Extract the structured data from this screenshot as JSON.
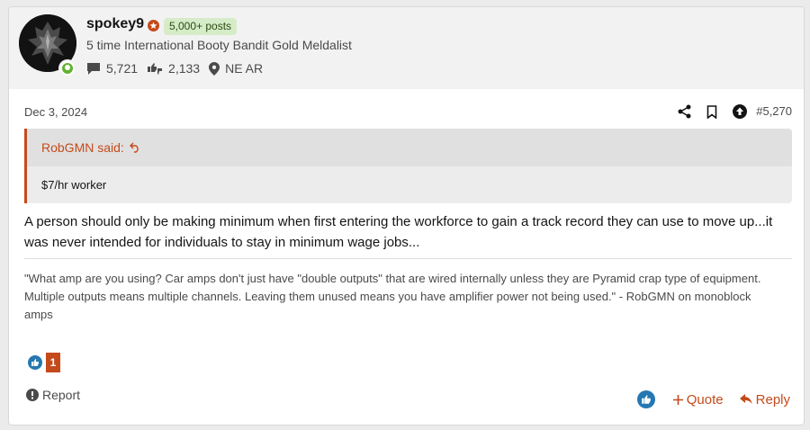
{
  "user": {
    "name": "spokey9",
    "post_badge": "5,000+ posts",
    "title": "5 time International Booty Bandit Gold Meldalist",
    "messages": "5,721",
    "reaction_score": "2,133",
    "location": "NE AR",
    "online_status_color": "#63b132"
  },
  "post": {
    "date": "Dec 3, 2024",
    "number": "#5,270",
    "quote": {
      "author_label": "RobGMN said:",
      "text": "$7/hr worker"
    },
    "body": "A person should only be making minimum when first entering the workforce to gain a track record they can use to move up...it was never intended for individuals to stay in minimum wage jobs...",
    "signature_line1": "\"What amp are you using? Car amps don't just have \"double outputs\" that are wired internally unless they are Pyramid crap type of equipment.",
    "signature_line2": "Multiple outputs means multiple channels. Leaving them unused means you have amplifier power not being used.\" - RobGMN on monoblock amps",
    "reaction_count": "1"
  },
  "actions": {
    "report": "Report",
    "quote": "Quote",
    "reply": "Reply"
  },
  "colors": {
    "accent": "#c44a1b",
    "like_blue": "#2577b1",
    "badge_green": "#d6ecc8"
  },
  "icons": [
    "share-icon",
    "bookmark-icon",
    "upvote-icon",
    "comment-icon",
    "thumbs-icon",
    "location-pin-icon",
    "reply-arrow-icon",
    "report-icon",
    "like-icon",
    "plus-icon"
  ]
}
